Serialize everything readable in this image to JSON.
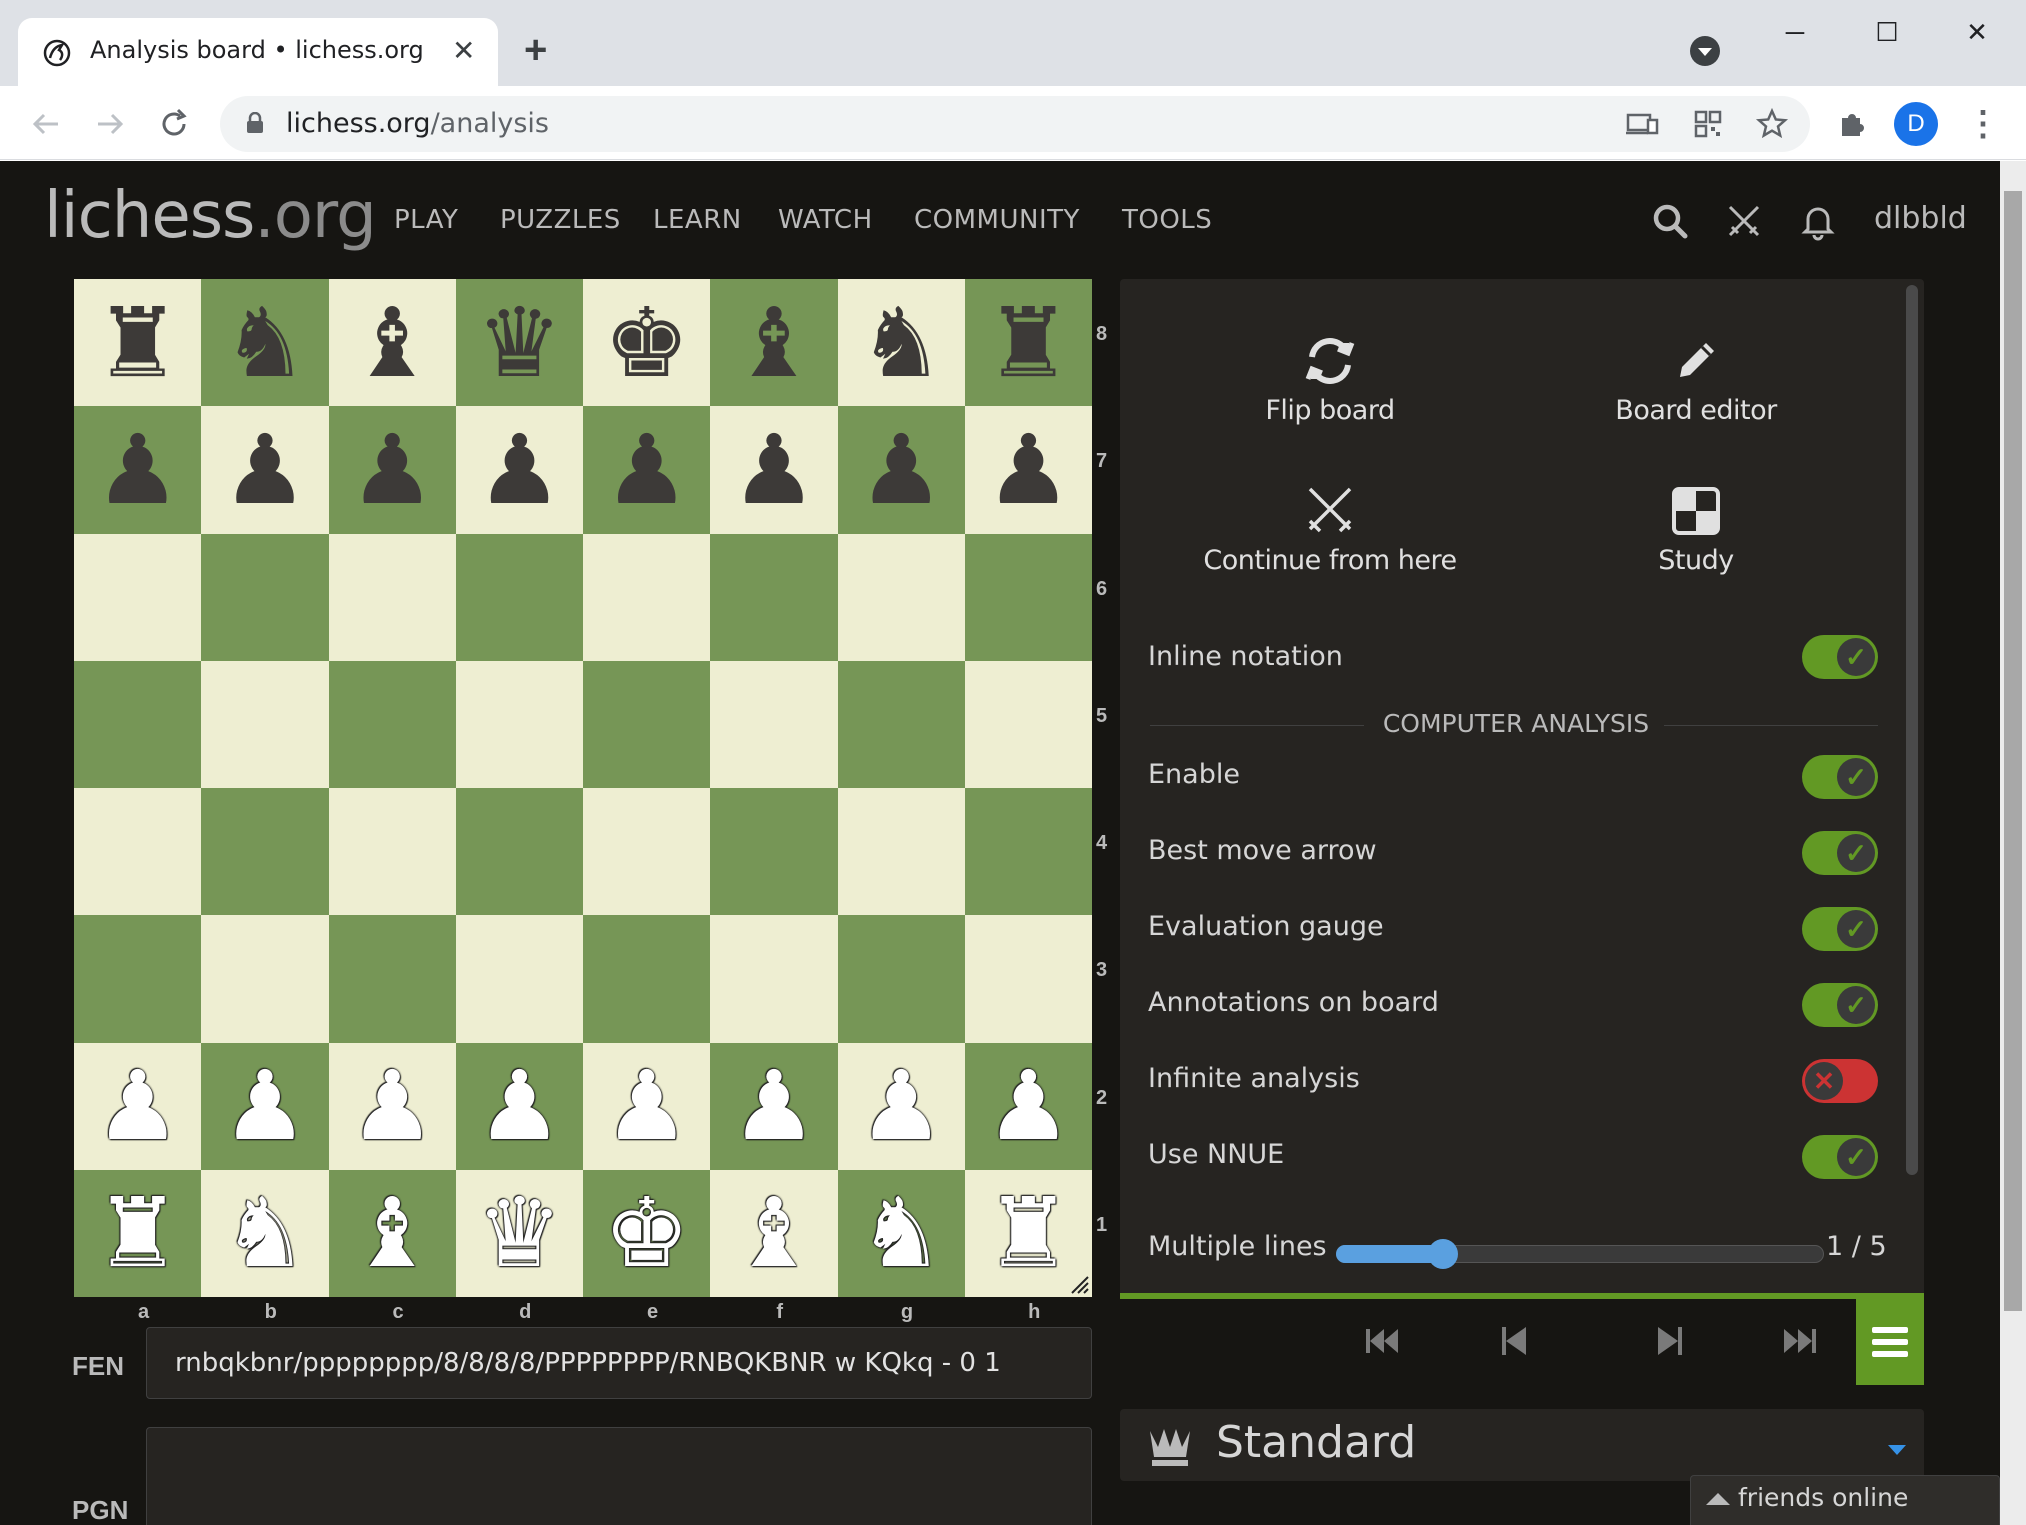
{
  "browser": {
    "tab_title": "Analysis board • lichess.org",
    "tab_close": "✕",
    "new_tab": "+",
    "url_domain": "lichess.org",
    "url_path": "/analysis",
    "profile_initial": "D",
    "window_controls": [
      "─",
      "☐",
      "✕"
    ]
  },
  "header": {
    "logo_main": "lichess",
    "logo_tld": ".org",
    "nav": [
      "PLAY",
      "PUZZLES",
      "LEARN",
      "WATCH",
      "COMMUNITY",
      "TOOLS"
    ],
    "username": "dlbbld"
  },
  "board": {
    "ranks": [
      "8",
      "7",
      "6",
      "5",
      "4",
      "3",
      "2",
      "1"
    ],
    "files": [
      "a",
      "b",
      "c",
      "d",
      "e",
      "f",
      "g",
      "h"
    ],
    "position": [
      [
        "r",
        "n",
        "b",
        "q",
        "k",
        "b",
        "n",
        "r"
      ],
      [
        "p",
        "p",
        "p",
        "p",
        "p",
        "p",
        "p",
        "p"
      ],
      [
        "",
        "",
        "",
        "",
        "",
        "",
        "",
        ""
      ],
      [
        "",
        "",
        "",
        "",
        "",
        "",
        "",
        ""
      ],
      [
        "",
        "",
        "",
        "",
        "",
        "",
        "",
        ""
      ],
      [
        "",
        "",
        "",
        "",
        "",
        "",
        "",
        ""
      ],
      [
        "P",
        "P",
        "P",
        "P",
        "P",
        "P",
        "P",
        "P"
      ],
      [
        "R",
        "N",
        "B",
        "Q",
        "K",
        "B",
        "N",
        "R"
      ]
    ],
    "light_square_color": "#eeeed2",
    "dark_square_color": "#769656"
  },
  "fen": {
    "label": "FEN",
    "value": "rnbqkbnr/pppppppp/8/8/8/8/PPPPPPPP/RNBQKBNR w KQkq - 0 1"
  },
  "pgn": {
    "label": "PGN",
    "value": ""
  },
  "tools": {
    "actions": {
      "flip_board": "Flip board",
      "board_editor": "Board editor",
      "continue_from_here": "Continue from here",
      "study": "Study"
    },
    "inline_notation": {
      "label": "Inline notation",
      "on": true
    },
    "computer_analysis_title": "COMPUTER ANALYSIS",
    "settings": [
      {
        "label": "Enable",
        "on": true
      },
      {
        "label": "Best move arrow",
        "on": true
      },
      {
        "label": "Evaluation gauge",
        "on": true
      },
      {
        "label": "Annotations on board",
        "on": true
      },
      {
        "label": "Infinite analysis",
        "on": false
      },
      {
        "label": "Use NNUE",
        "on": true
      }
    ],
    "multiple_lines": {
      "label": "Multiple lines",
      "value": 1,
      "max": 5,
      "display": "1 / 5"
    },
    "accent_color": "#629924",
    "off_color": "#cc3333"
  },
  "variant": {
    "label": "Standard"
  },
  "friends": {
    "label": "friends online"
  }
}
